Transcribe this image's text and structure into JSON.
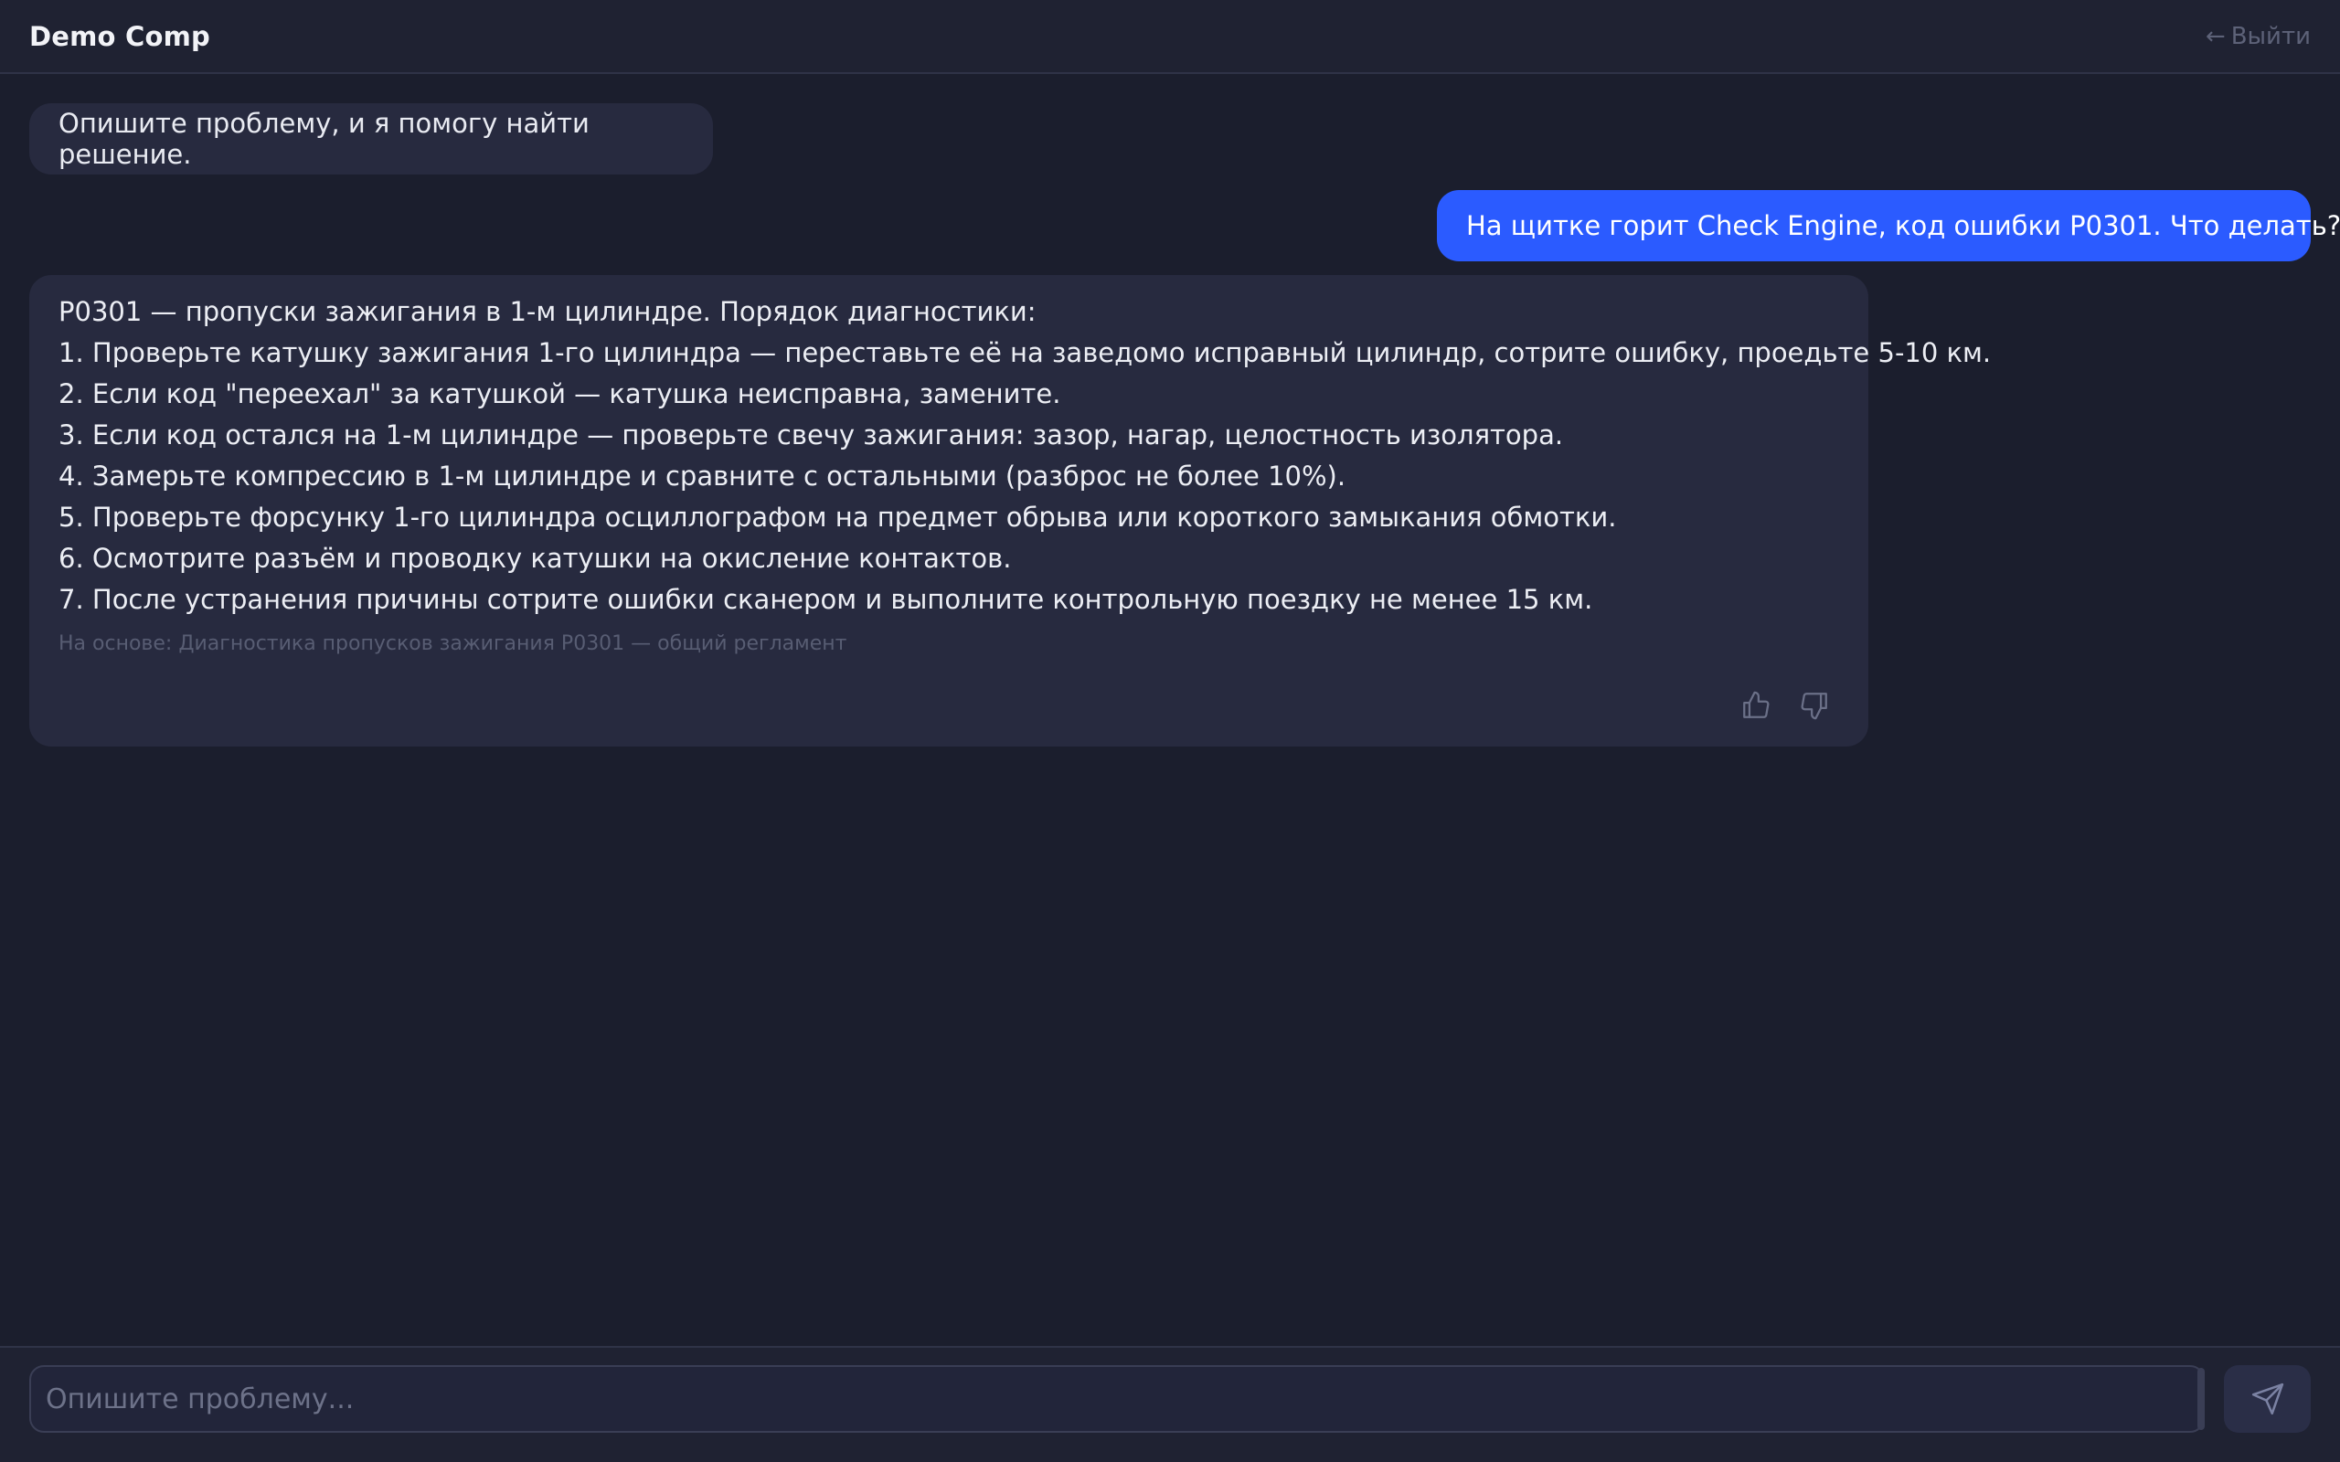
{
  "header": {
    "title": "Demo Comp",
    "logout_arrow": "←",
    "logout_label": "Выйти"
  },
  "messages": {
    "greeting": "Опишите проблему, и я помогу найти решение.",
    "user_question": "На щитке горит Check Engine, код ошибки P0301. Что делать?",
    "answer_lines": [
      "P0301 — пропуски зажигания в 1-м цилиндре. Порядок диагностики:",
      "1. Проверьте катушку зажигания 1-го цилиндра — переставьте её на заведомо исправный цилиндр, сотрите ошибку, проедьте 5-10 км.",
      "2. Если код \"переехал\" за катушкой — катушка неисправна, замените.",
      "3. Если код остался на 1-м цилиндре — проверьте свечу зажигания: зазор, нагар, целостность изолятора.",
      "4. Замерьте компрессию в 1-м цилиндре и сравните с остальными (разброс не более 10%).",
      "5. Проверьте форсунку 1-го цилиндра осциллографом на предмет обрыва или короткого замыкания обмотки.",
      "6. Осмотрите разъём и проводку катушки на окисление контактов.",
      "7. После устранения причины сотрите ошибки сканером и выполните контрольную поездку не менее 15 км."
    ],
    "source": "На основе: Диагностика пропусков зажигания P0301 — общий регламент",
    "feedback_icons": [
      "thumbs-up-icon",
      "thumbs-down-icon"
    ]
  },
  "composer": {
    "placeholder": "Опишите проблему...",
    "value": "",
    "send_icon": "send-icon"
  },
  "colors": {
    "background": "#1b1e2d",
    "header": "#1f2232",
    "bot_bubble": "#272a3f",
    "user_bubble": "#2b5bff",
    "muted_text": "#585d73"
  }
}
